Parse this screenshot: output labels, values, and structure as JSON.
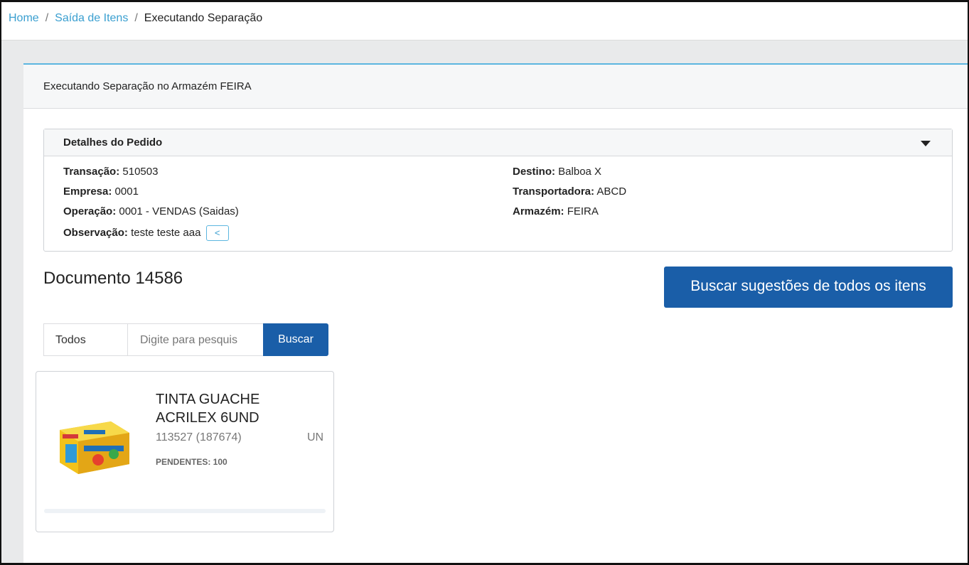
{
  "breadcrumb": {
    "home": "Home",
    "section": "Saída de Itens",
    "current": "Executando Separação",
    "separator": "/"
  },
  "card": {
    "title": "Executando Separação no Armazém FEIRA"
  },
  "details": {
    "title": "Detalhes do Pedido",
    "left": [
      {
        "label": "Transação:",
        "value": "510503"
      },
      {
        "label": "Empresa:",
        "value": "0001"
      },
      {
        "label": "Operação:",
        "value": "0001 - VENDAS (Saidas)"
      },
      {
        "label": "Observação:",
        "value": "teste teste aaa"
      }
    ],
    "right": [
      {
        "label": "Destino:",
        "value": "Balboa X"
      },
      {
        "label": "Transportadora:",
        "value": "ABCD"
      },
      {
        "label": "Armazém:",
        "value": "FEIRA"
      }
    ],
    "observation_toggle": "<"
  },
  "document": {
    "title": "Documento 14586"
  },
  "actions": {
    "suggest_all": "Buscar sugestões de todos os itens"
  },
  "filter": {
    "select_value": "Todos",
    "search_placeholder": "Digite para pesquis",
    "search_button": "Buscar"
  },
  "product": {
    "name": "TINTA GUACHE ACRILEX 6UND",
    "code": "113527 (187674)",
    "unit": "UN",
    "pending": "PENDENTES: 100",
    "pending_fraction": 0
  },
  "colors": {
    "accent": "#3a9fd0",
    "primary_button": "#1a5ea8",
    "card_top_border": "#5cb6e0"
  }
}
